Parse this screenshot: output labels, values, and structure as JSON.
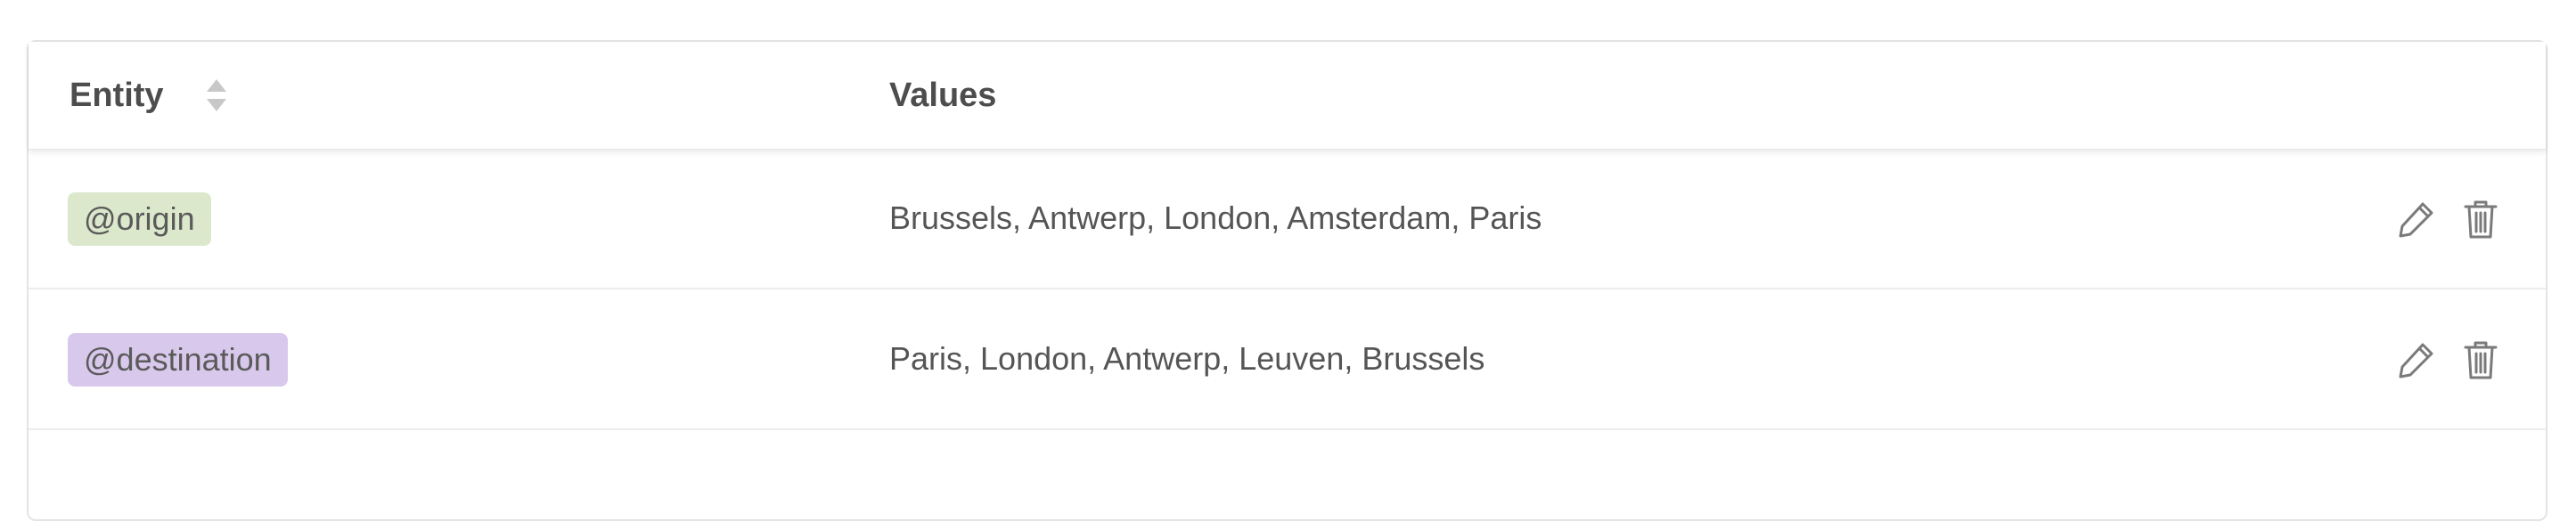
{
  "table": {
    "columns": {
      "entity": "Entity",
      "values": "Values"
    },
    "rows": [
      {
        "entity": "@origin",
        "tag_color": "#dce8cc",
        "values": "Brussels, Antwerp, London, Amsterdam, Paris"
      },
      {
        "entity": "@destination",
        "tag_color": "#d8c9ec",
        "values": "Paris, London, Antwerp, Leuven, Brussels"
      }
    ],
    "icons": {
      "sort": "sort-icon",
      "edit": "pencil-icon",
      "delete": "trash-icon"
    }
  }
}
